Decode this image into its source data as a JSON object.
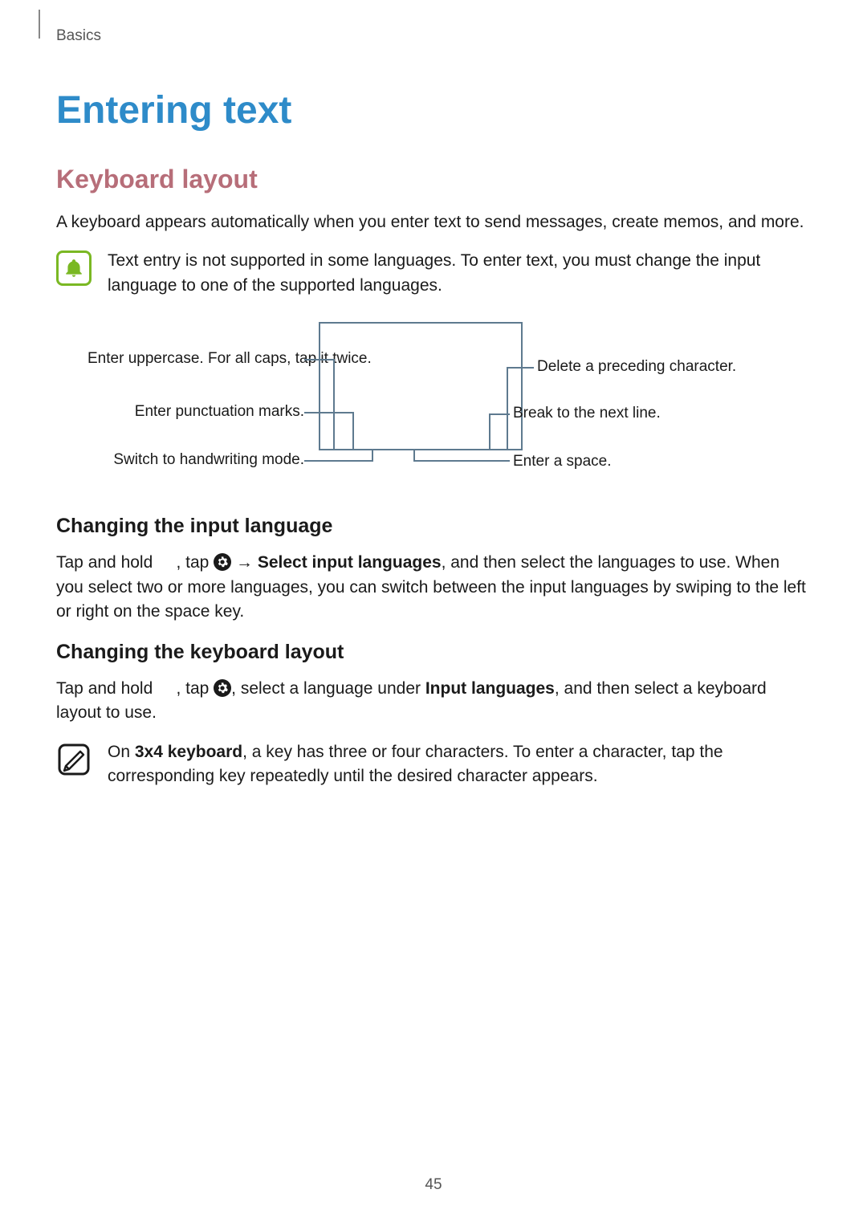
{
  "header": {
    "chapter": "Basics"
  },
  "page_number": "45",
  "title": "Entering text",
  "section1": {
    "heading": "Keyboard layout",
    "intro": "A keyboard appears automatically when you enter text to send messages, create memos, and more.",
    "note": "Text entry is not supported in some languages. To enter text, you must change the input language to one of the supported languages."
  },
  "diagram": {
    "left": {
      "uppercase": "Enter uppercase. For all caps, tap it twice.",
      "punctuation": "Enter punctuation marks.",
      "handwriting": "Switch to handwriting mode."
    },
    "right": {
      "delete": "Delete a preceding character.",
      "nextline": "Break to the next line.",
      "space": "Enter a space."
    }
  },
  "section2": {
    "heading": "Changing the input language",
    "p1_a": "Tap and hold ",
    "p1_b": ", tap ",
    "arrow": "→",
    "bold1": "Select input languages",
    "p1_c": ", and then select the languages to use. When you select two or more languages, you can switch between the input languages by swiping to the left or right on the space key."
  },
  "section3": {
    "heading": "Changing the keyboard layout",
    "p1_a": "Tap and hold ",
    "p1_b": ", tap ",
    "p1_c": ", select a language under ",
    "bold1": "Input languages",
    "p1_d": ", and then select a keyboard layout to use."
  },
  "section4": {
    "note_a": "On ",
    "bold1": "3x4 keyboard",
    "note_b": ", a key has three or four characters. To enter a character, tap the corresponding key repeatedly until the desired character appears."
  }
}
